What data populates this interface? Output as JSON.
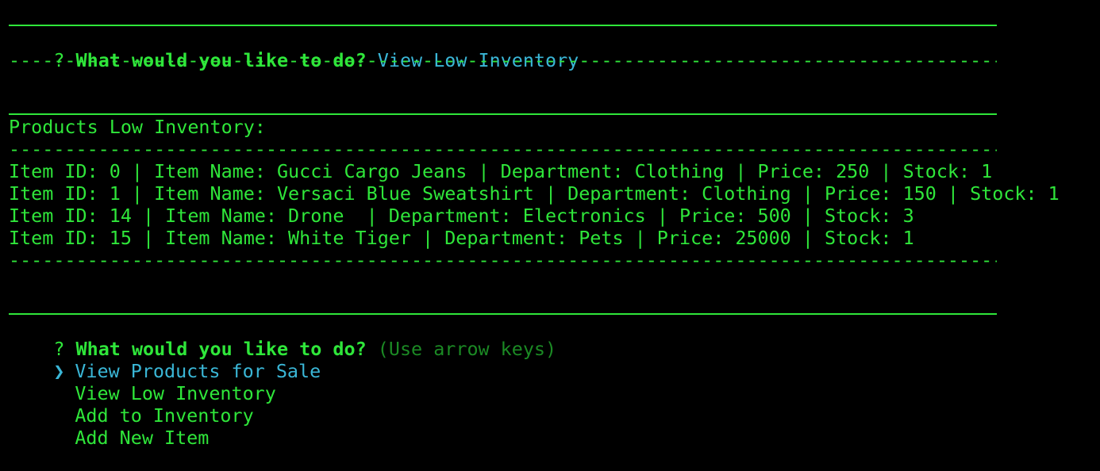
{
  "colors": {
    "background": "#000000",
    "text_green": "#2fe63a",
    "answer_cyan": "#3ab6d6",
    "hint_dim_green": "#1b8a24"
  },
  "prompt1": {
    "mark": "?",
    "question": "What would you like to do?",
    "answer": "View Low Inventory"
  },
  "separator": "--------------------------------------------------------------------------------------------",
  "report": {
    "heading": "Products Low Inventory:",
    "rows": [
      "Item ID: 0 | Item Name: Gucci Cargo Jeans | Department: Clothing | Price: 250 | Stock: 1",
      "Item ID: 1 | Item Name: Versaci Blue Sweatshirt | Department: Clothing | Price: 150 | Stock: 1",
      "Item ID: 14 | Item Name: Drone  | Department: Electronics | Price: 500 | Stock: 3",
      "Item ID: 15 | Item Name: White Tiger | Department: Pets | Price: 25000 | Stock: 1"
    ]
  },
  "prompt2": {
    "mark": "?",
    "question": "What would you like to do?",
    "hint": "(Use arrow keys)",
    "pointer_icon": "❯",
    "choices": [
      "View Products for Sale",
      "View Low Inventory",
      "Add to Inventory",
      "Add New Item"
    ],
    "selected_index": 0
  }
}
